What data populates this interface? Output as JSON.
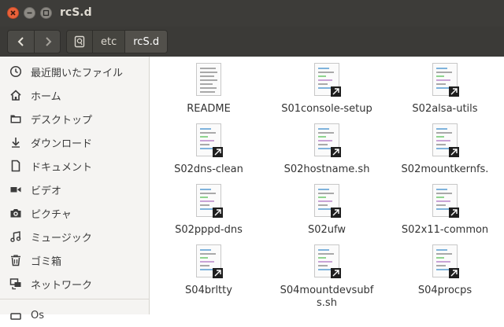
{
  "window": {
    "title": "rcS.d"
  },
  "path": {
    "crumbs": [
      "etc",
      "rcS.d"
    ]
  },
  "sidebar": {
    "items": [
      {
        "label": "最近開いたファイル",
        "icon": "clock-icon"
      },
      {
        "label": "ホーム",
        "icon": "home-icon"
      },
      {
        "label": "デスクトップ",
        "icon": "folder-icon"
      },
      {
        "label": "ダウンロード",
        "icon": "download-icon"
      },
      {
        "label": "ドキュメント",
        "icon": "document-icon"
      },
      {
        "label": "ビデオ",
        "icon": "video-icon"
      },
      {
        "label": "ピクチャ",
        "icon": "camera-icon"
      },
      {
        "label": "ミュージック",
        "icon": "music-icon"
      },
      {
        "label": "ゴミ箱",
        "icon": "trash-icon"
      },
      {
        "label": "ネットワーク",
        "icon": "network-icon"
      }
    ],
    "partial_label": "Os"
  },
  "files": [
    {
      "name": "README",
      "type": "text"
    },
    {
      "name": "S01console-setup",
      "type": "script"
    },
    {
      "name": "S02alsa-utils",
      "type": "script"
    },
    {
      "name": "S02dns-clean",
      "type": "script"
    },
    {
      "name": "S02hostname.sh",
      "type": "script"
    },
    {
      "name": "S02mountkernfs.",
      "type": "script"
    },
    {
      "name": "S02pppd-dns",
      "type": "script"
    },
    {
      "name": "S02ufw",
      "type": "script"
    },
    {
      "name": "S02x11-common",
      "type": "script"
    },
    {
      "name": "S04brltty",
      "type": "script"
    },
    {
      "name": "S04mountdevsubf",
      "name2": "s.sh",
      "type": "script"
    },
    {
      "name": "S04procps",
      "type": "script"
    }
  ]
}
